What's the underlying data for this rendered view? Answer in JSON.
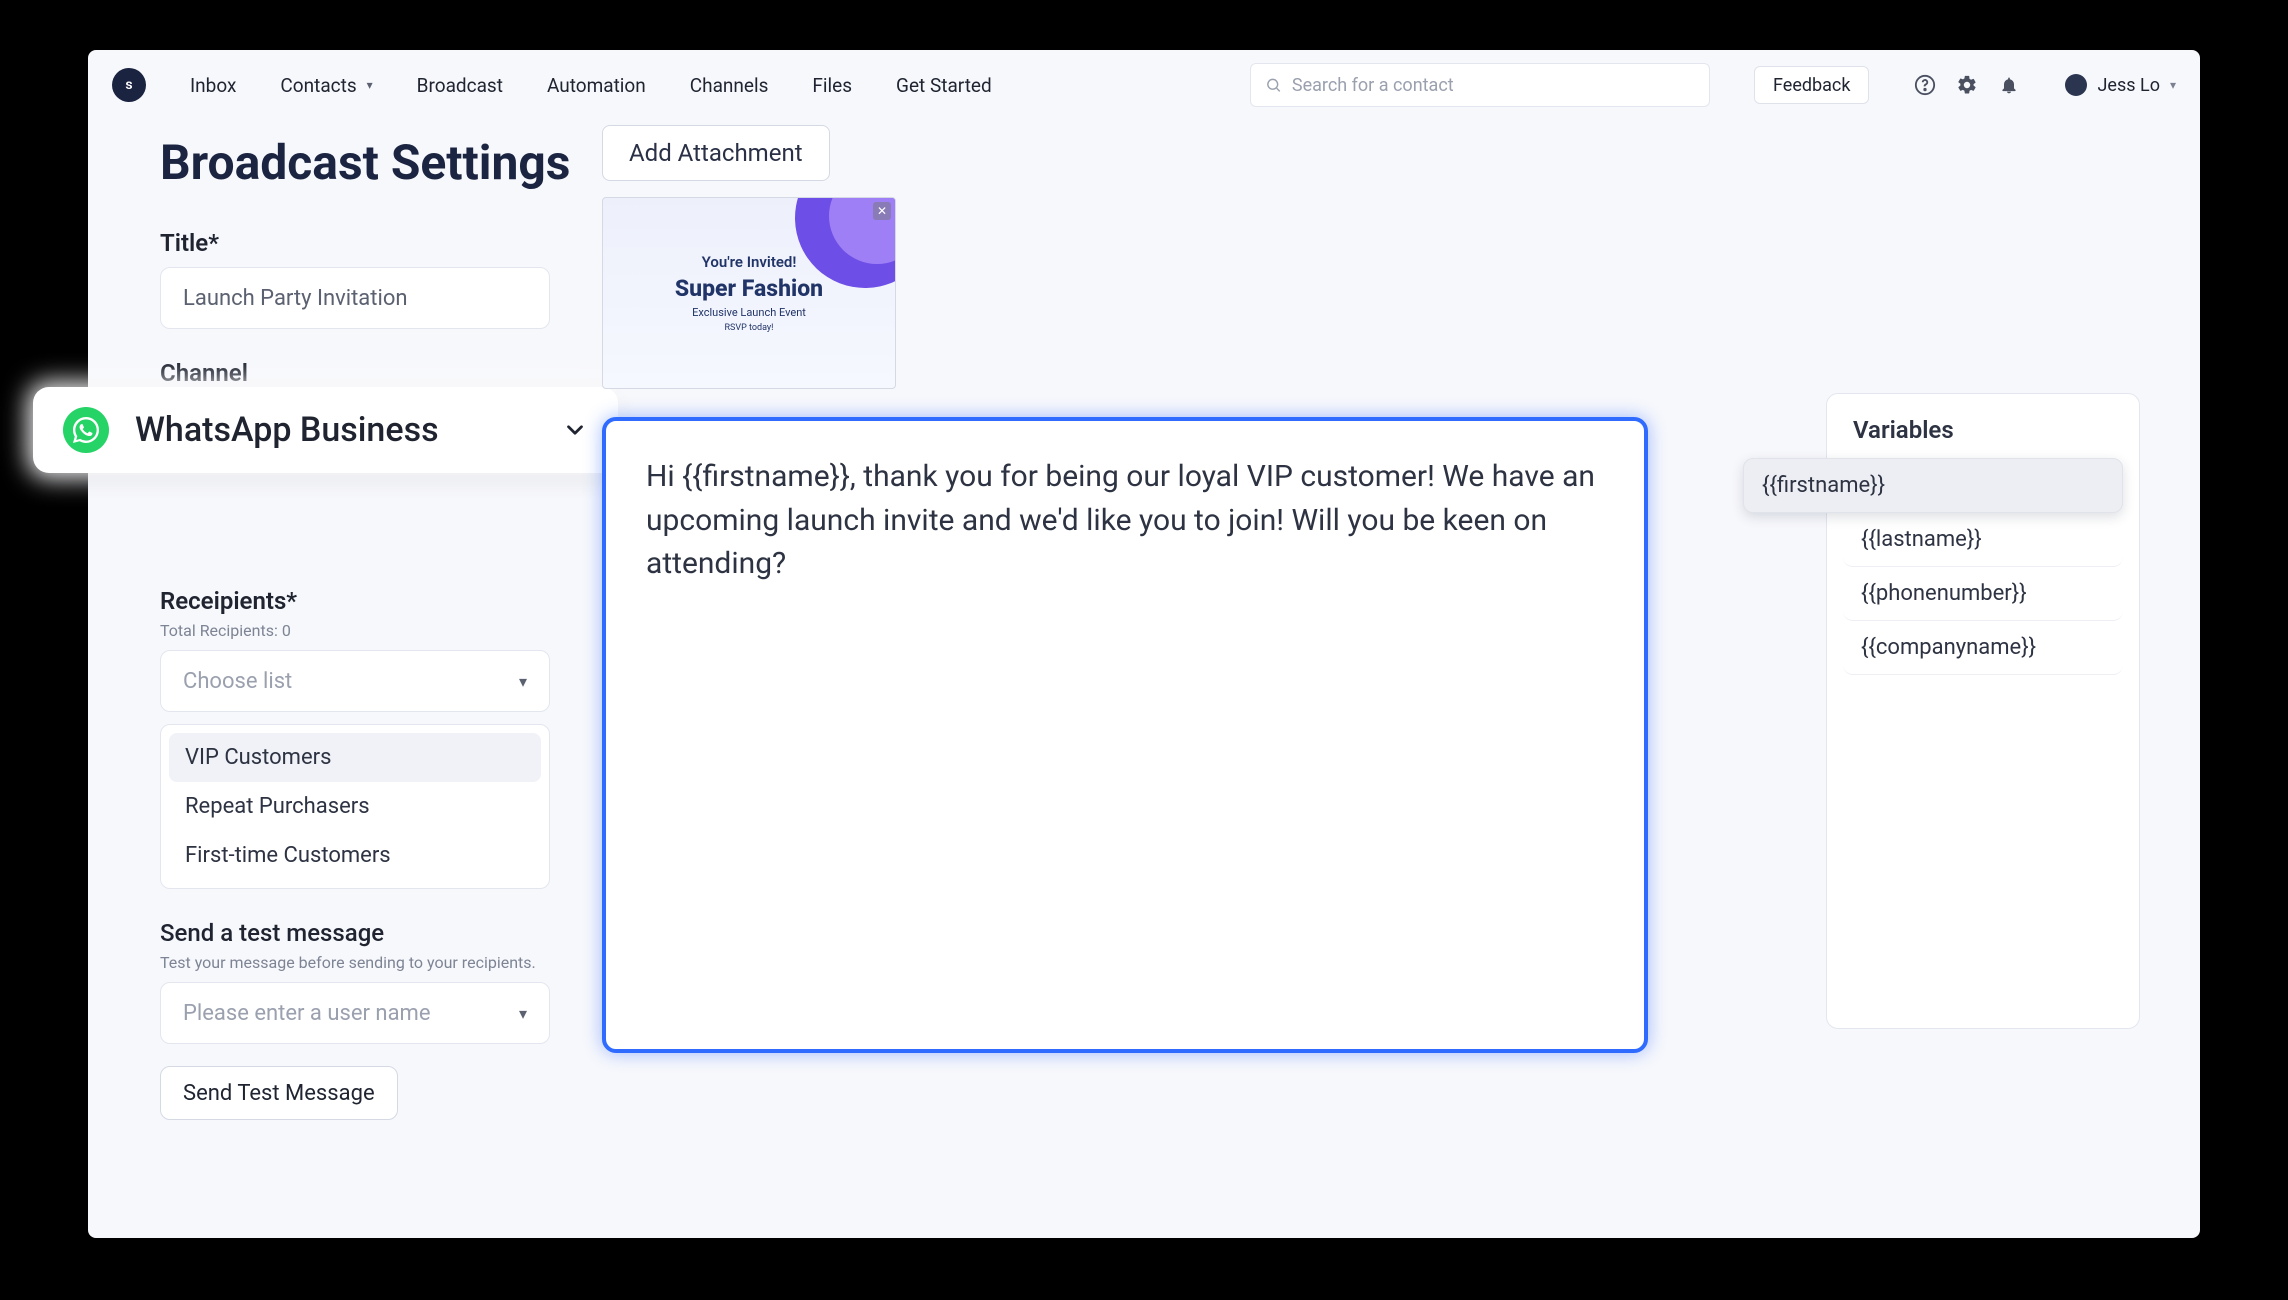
{
  "brand_initial": "s",
  "nav": {
    "items": [
      "Inbox",
      "Contacts",
      "Broadcast",
      "Automation",
      "Channels",
      "Files",
      "Get Started"
    ],
    "contacts_has_chevron": true
  },
  "search": {
    "placeholder": "Search for a contact"
  },
  "feedback_label": "Feedback",
  "user": {
    "name": "Jess Lo"
  },
  "page": {
    "title": "Broadcast Settings"
  },
  "title_field": {
    "label": "Title*",
    "value": "Launch Party Invitation"
  },
  "channel_field": {
    "label": "Channel",
    "value": "WhatsApp Business"
  },
  "recipients_field": {
    "label": "Receipients*",
    "sub": "Total Recipients: 0",
    "placeholder": "Choose list",
    "options": [
      "VIP Customers",
      "Repeat Purchasers",
      "First-time Customers"
    ],
    "selected_index": 0
  },
  "test_field": {
    "label": "Send a test message",
    "sub": "Test your message before sending to your recipients.",
    "placeholder": "Please enter a user name",
    "button": "Send Test Message"
  },
  "attachment": {
    "button": "Add Attachment",
    "preview": {
      "line1": "You're Invited!",
      "line2": "Super Fashion",
      "line3": "Exclusive Launch Event",
      "line4": "RSVP today!"
    }
  },
  "message_body": "Hi {{firstname}}, thank you for being our loyal VIP customer! We have an upcoming launch invite and we'd like you to join! Will you be keen on attending?",
  "variables": {
    "title": "Variables",
    "items": [
      "{{firstname}}",
      "{{lastname}}",
      "{{phonenumber}}",
      "{{companyname}}"
    ],
    "highlight_index": 0
  }
}
